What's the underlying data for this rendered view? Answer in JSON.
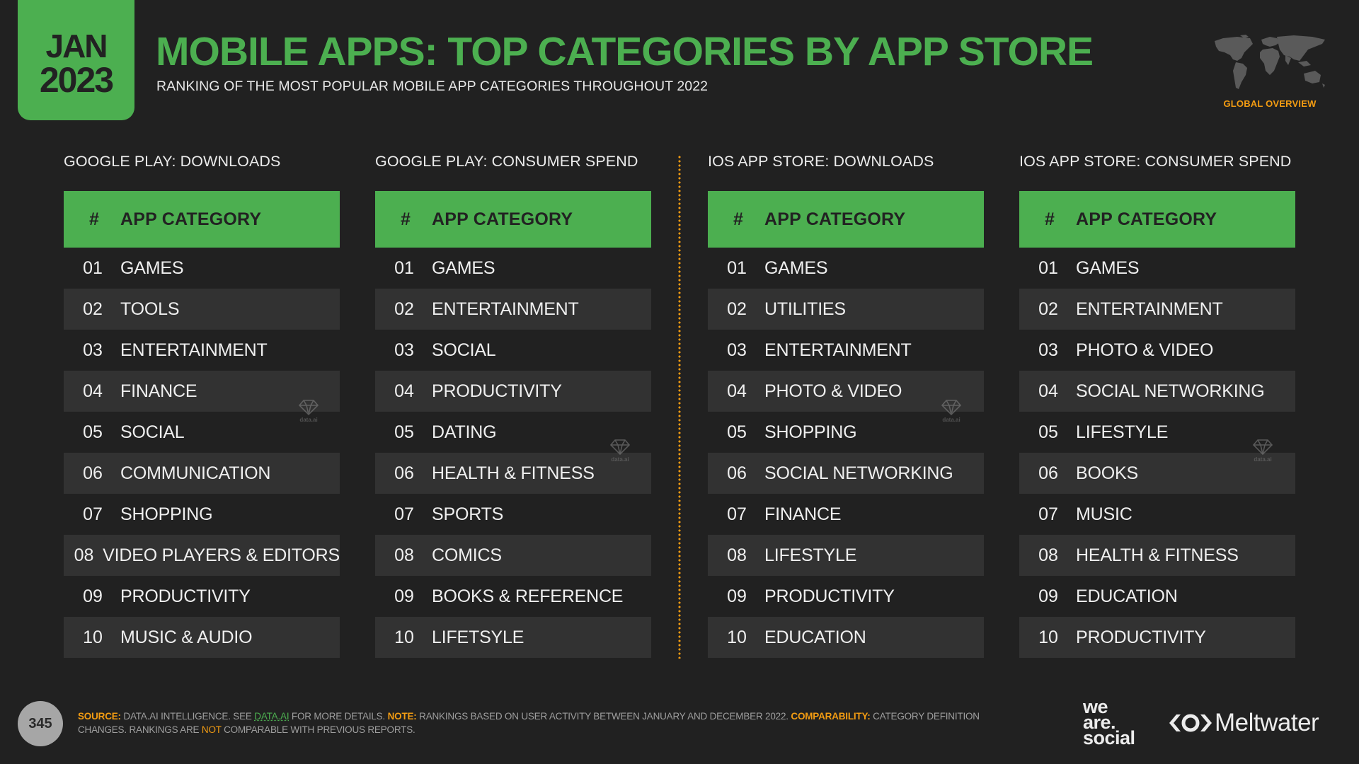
{
  "header": {
    "date_month": "JAN",
    "date_year": "2023",
    "title": "MOBILE APPS: TOP CATEGORIES BY APP STORE",
    "subtitle": "RANKING OF THE MOST POPULAR MOBILE APP CATEGORIES THROUGHOUT 2022",
    "region_label": "GLOBAL OVERVIEW",
    "map_icon": "world-map-icon"
  },
  "colors": {
    "accent_green": "#4caf50",
    "accent_orange": "#f39c12",
    "background": "#212121",
    "row_alt": "#323232"
  },
  "table_header": {
    "rank_label": "#",
    "category_label": "APP CATEGORY"
  },
  "sections": [
    {
      "title": "GOOGLE PLAY: DOWNLOADS",
      "rows": [
        {
          "rank": "01",
          "category": "GAMES"
        },
        {
          "rank": "02",
          "category": "TOOLS"
        },
        {
          "rank": "03",
          "category": "ENTERTAINMENT"
        },
        {
          "rank": "04",
          "category": "FINANCE"
        },
        {
          "rank": "05",
          "category": "SOCIAL"
        },
        {
          "rank": "06",
          "category": "COMMUNICATION"
        },
        {
          "rank": "07",
          "category": "SHOPPING"
        },
        {
          "rank": "08",
          "category": "VIDEO PLAYERS & EDITORS"
        },
        {
          "rank": "09",
          "category": "PRODUCTIVITY"
        },
        {
          "rank": "10",
          "category": "MUSIC & AUDIO"
        }
      ]
    },
    {
      "title": "GOOGLE PLAY: CONSUMER SPEND",
      "rows": [
        {
          "rank": "01",
          "category": "GAMES"
        },
        {
          "rank": "02",
          "category": "ENTERTAINMENT"
        },
        {
          "rank": "03",
          "category": "SOCIAL"
        },
        {
          "rank": "04",
          "category": "PRODUCTIVITY"
        },
        {
          "rank": "05",
          "category": "DATING"
        },
        {
          "rank": "06",
          "category": "HEALTH & FITNESS"
        },
        {
          "rank": "07",
          "category": "SPORTS"
        },
        {
          "rank": "08",
          "category": "COMICS"
        },
        {
          "rank": "09",
          "category": "BOOKS & REFERENCE"
        },
        {
          "rank": "10",
          "category": "LIFETSYLE"
        }
      ]
    },
    {
      "title": "IOS APP STORE: DOWNLOADS",
      "rows": [
        {
          "rank": "01",
          "category": "GAMES"
        },
        {
          "rank": "02",
          "category": "UTILITIES"
        },
        {
          "rank": "03",
          "category": "ENTERTAINMENT"
        },
        {
          "rank": "04",
          "category": "PHOTO & VIDEO"
        },
        {
          "rank": "05",
          "category": "SHOPPING"
        },
        {
          "rank": "06",
          "category": "SOCIAL NETWORKING"
        },
        {
          "rank": "07",
          "category": "FINANCE"
        },
        {
          "rank": "08",
          "category": "LIFESTYLE"
        },
        {
          "rank": "09",
          "category": "PRODUCTIVITY"
        },
        {
          "rank": "10",
          "category": "EDUCATION"
        }
      ]
    },
    {
      "title": "IOS APP STORE: CONSUMER SPEND",
      "rows": [
        {
          "rank": "01",
          "category": "GAMES"
        },
        {
          "rank": "02",
          "category": "ENTERTAINMENT"
        },
        {
          "rank": "03",
          "category": "PHOTO & VIDEO"
        },
        {
          "rank": "04",
          "category": "SOCIAL NETWORKING"
        },
        {
          "rank": "05",
          "category": "LIFESTYLE"
        },
        {
          "rank": "06",
          "category": "BOOKS"
        },
        {
          "rank": "07",
          "category": "MUSIC"
        },
        {
          "rank": "08",
          "category": "HEALTH & FITNESS"
        },
        {
          "rank": "09",
          "category": "EDUCATION"
        },
        {
          "rank": "10",
          "category": "PRODUCTIVITY"
        }
      ]
    }
  ],
  "watermark": {
    "label": "data.ai",
    "icon": "diamond-icon"
  },
  "footer": {
    "page_number": "345",
    "source_label": "SOURCE:",
    "source_text_1": " DATA.AI INTELLIGENCE. SEE ",
    "source_link": "DATA.AI",
    "source_text_2": " FOR MORE DETAILS. ",
    "note_label": "NOTE:",
    "note_text": " RANKINGS BASED ON USER ACTIVITY BETWEEN JANUARY AND DECEMBER 2022. ",
    "comparability_label": "COMPARABILITY:",
    "comparability_text_1": " CATEGORY DEFINITION CHANGES. RANKINGS ARE ",
    "comparability_not": "NOT",
    "comparability_text_2": " COMPARABLE WITH PREVIOUS REPORTS.",
    "logo_was_line1": "we",
    "logo_was_line2": "are.",
    "logo_was_line3": "social",
    "logo_meltwater": "Meltwater"
  }
}
